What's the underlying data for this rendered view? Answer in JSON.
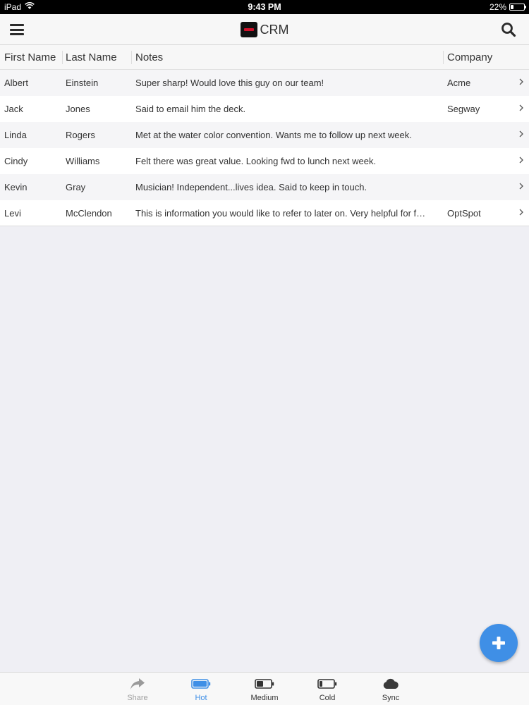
{
  "status_bar": {
    "device": "iPad",
    "time": "9:43 PM",
    "battery_text": "22%",
    "battery_level": 0.22
  },
  "header": {
    "title": "CRM",
    "menu_icon": "hamburger-menu-icon",
    "search_icon": "search-icon"
  },
  "table": {
    "columns": [
      "First Name",
      "Last Name",
      "Notes",
      "Company"
    ],
    "rows": [
      {
        "first": "Albert",
        "last": "Einstein",
        "notes": "Super sharp! Would love this guy on our team!",
        "company": "Acme"
      },
      {
        "first": "Jack",
        "last": "Jones",
        "notes": "Said to email him the deck.",
        "company": "Segway"
      },
      {
        "first": "Linda",
        "last": "Rogers",
        "notes": "Met at the water color convention. Wants me to follow up next week.",
        "company": ""
      },
      {
        "first": "Cindy",
        "last": "Williams",
        "notes": "Felt there was great value. Looking fwd to lunch next week.",
        "company": ""
      },
      {
        "first": "Kevin",
        "last": "Gray",
        "notes": "Musician! Independent...lives idea. Said to keep in touch.",
        "company": ""
      },
      {
        "first": "Levi",
        "last": "McClendon",
        "notes": "This is information you would like to refer to later on. Very helpful for f…",
        "company": "OptSpot"
      }
    ]
  },
  "tabbar": {
    "tabs": [
      {
        "label": "Share",
        "icon": "share-arrow-icon",
        "state": "disabled"
      },
      {
        "label": "Hot",
        "icon": "battery-full-icon",
        "state": "active"
      },
      {
        "label": "Medium",
        "icon": "battery-medium-icon",
        "state": "normal"
      },
      {
        "label": "Cold",
        "icon": "battery-low-icon",
        "state": "normal"
      },
      {
        "label": "Sync",
        "icon": "cloud-icon",
        "state": "normal"
      }
    ]
  },
  "colors": {
    "accent": "#3f8fe6",
    "logo_red": "#d0112b"
  },
  "fab": {
    "icon": "plus-icon"
  }
}
